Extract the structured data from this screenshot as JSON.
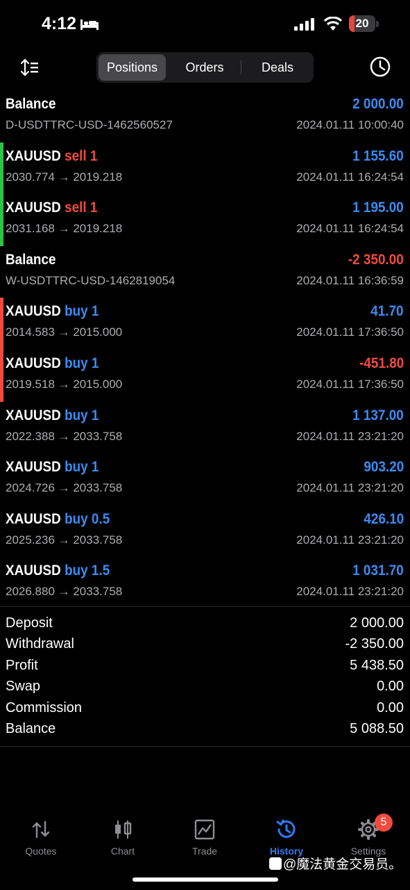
{
  "status_bar": {
    "time": "4:12",
    "battery": "20",
    "battery_level": 0.2,
    "battery_color": "#e8453c"
  },
  "tabs_segment": {
    "items": [
      "Positions",
      "Orders",
      "Deals"
    ],
    "active": "Positions"
  },
  "rows": [
    {
      "title": "Balance",
      "side": "",
      "sub": "D-USDTTRC-USD-1462560527",
      "amount": "2 000.00",
      "amount_color": "blue",
      "time": "2024.01.11 10:00:40",
      "indicator": ""
    },
    {
      "title": "XAUUSD",
      "side": "sell 1",
      "side_color": "red",
      "sub": "2030.774 → 2019.218",
      "amount": "1 155.60",
      "amount_color": "blue",
      "time": "2024.01.11 16:24:54",
      "indicator": "#2fc244"
    },
    {
      "title": "XAUUSD",
      "side": "sell 1",
      "side_color": "red",
      "sub": "2031.168 → 2019.218",
      "amount": "1 195.00",
      "amount_color": "blue",
      "time": "2024.01.11 16:24:54",
      "indicator": "#2fc244"
    },
    {
      "title": "Balance",
      "side": "",
      "sub": "W-USDTTRC-USD-1462819054",
      "amount": "-2 350.00",
      "amount_color": "red",
      "time": "2024.01.11 16:36:59",
      "indicator": ""
    },
    {
      "title": "XAUUSD",
      "side": "buy 1",
      "side_color": "blue",
      "sub": "2014.583 → 2015.000",
      "amount": "41.70",
      "amount_color": "blue",
      "time": "2024.01.11 17:36:50",
      "indicator": "#f04b3e"
    },
    {
      "title": "XAUUSD",
      "side": "buy 1",
      "side_color": "blue",
      "sub": "2019.518 → 2015.000",
      "amount": "-451.80",
      "amount_color": "red",
      "time": "2024.01.11 17:36:50",
      "indicator": "#f04b3e"
    },
    {
      "title": "XAUUSD",
      "side": "buy 1",
      "side_color": "blue",
      "sub": "2022.388 → 2033.758",
      "amount": "1 137.00",
      "amount_color": "blue",
      "time": "2024.01.11 23:21:20",
      "indicator": ""
    },
    {
      "title": "XAUUSD",
      "side": "buy 1",
      "side_color": "blue",
      "sub": "2024.726 → 2033.758",
      "amount": "903.20",
      "amount_color": "blue",
      "time": "2024.01.11 23:21:20",
      "indicator": ""
    },
    {
      "title": "XAUUSD",
      "side": "buy 0.5",
      "side_color": "blue",
      "sub": "2025.236 → 2033.758",
      "amount": "426.10",
      "amount_color": "blue",
      "time": "2024.01.11 23:21:20",
      "indicator": ""
    },
    {
      "title": "XAUUSD",
      "side": "buy 1.5",
      "side_color": "blue",
      "sub": "2026.880 → 2033.758",
      "amount": "1 031.70",
      "amount_color": "blue",
      "time": "2024.01.11 23:21:20",
      "indicator": ""
    }
  ],
  "summary": [
    {
      "label": "Deposit",
      "value": "2 000.00"
    },
    {
      "label": "Withdrawal",
      "value": "-2 350.00"
    },
    {
      "label": "Profit",
      "value": "5 438.50"
    },
    {
      "label": "Swap",
      "value": "0.00"
    },
    {
      "label": "Commission",
      "value": "0.00"
    },
    {
      "label": "Balance",
      "value": "5 088.50"
    }
  ],
  "tabbar": {
    "items": [
      {
        "label": "Quotes",
        "icon": "quotes-arrows-icon"
      },
      {
        "label": "Chart",
        "icon": "candlestick-icon"
      },
      {
        "label": "Trade",
        "icon": "trade-chart-icon"
      },
      {
        "label": "History",
        "icon": "history-icon"
      },
      {
        "label": "Settings",
        "icon": "gear-icon"
      }
    ],
    "active": "History",
    "settings_badge": "5"
  },
  "watermark": "@魔法黄金交易员。",
  "colors": {
    "blue": "#3b8cf2",
    "red": "#f04b3e",
    "green": "#2fc244",
    "active_tab": "#2f7bf5"
  }
}
